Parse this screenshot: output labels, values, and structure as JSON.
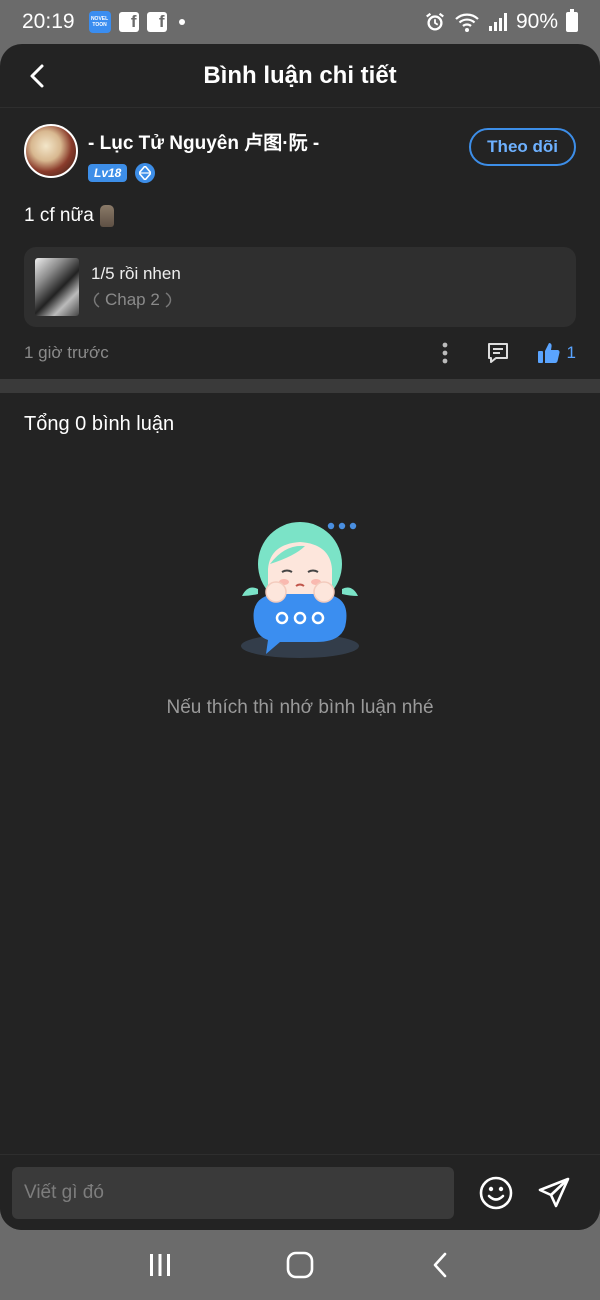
{
  "status_bar": {
    "time": "20:19",
    "novel_app_label": "NOVEL TOON",
    "battery": "90%"
  },
  "header": {
    "title": "Bình luận chi tiết"
  },
  "comment": {
    "author": "- Lục Tử Nguyên 卢图·阮 -",
    "level": "Lv18",
    "follow_label": "Theo dõi",
    "text": "1 cf nữa",
    "chapter": {
      "title": "1/5 rồi nhen",
      "subtitle": "Chap 2"
    },
    "time_ago": "1 giờ trước",
    "likes": "1"
  },
  "comments_section": {
    "total_label": "Tổng 0 bình luận",
    "empty_message": "Nếu thích thì nhớ bình luận nhé"
  },
  "input_bar": {
    "placeholder": "Viết gì đó"
  },
  "colors": {
    "accent": "#3d8ee8",
    "background": "#232323",
    "card": "#2f2f2f"
  }
}
